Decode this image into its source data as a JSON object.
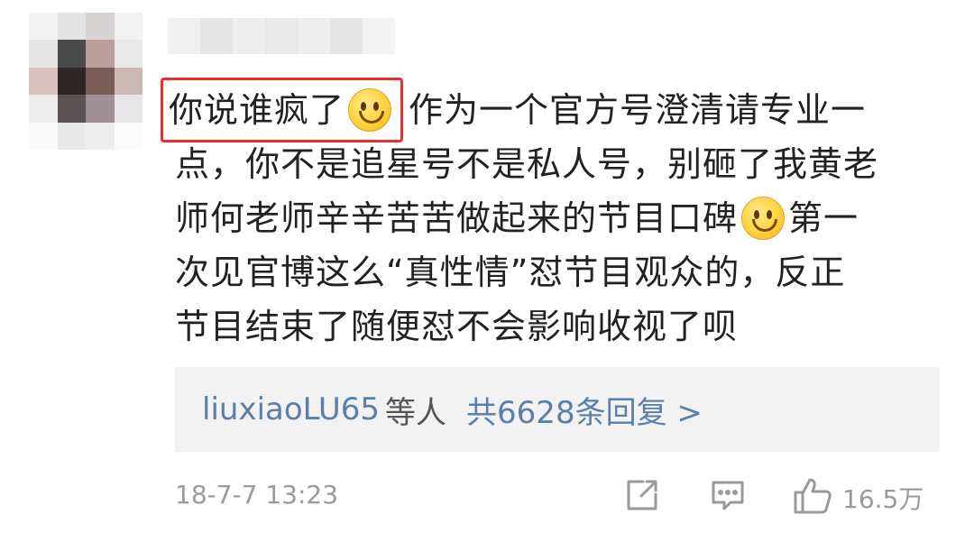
{
  "comment": {
    "highlight": "你说谁疯了",
    "line1_rest": "作为一个官方号澄清请专业一",
    "line2": "点，你不是追星号不是私人号，别砸了我黄老",
    "line3_pre": "师何老师辛辛苦苦做起来的节目口碑",
    "line3_post": "第一",
    "line4": "次见官博这么“真性情”怼节目观众的，反正",
    "line5": "节目结束了随便怼不会影响收视了呗"
  },
  "replies": {
    "user": "liuxiaoLU65",
    "suffix": "等人",
    "count_text": "共6628条回复 >"
  },
  "footer": {
    "timestamp": "18-7-7 13:23",
    "likes": "16.5万",
    "icons": [
      "share-icon",
      "comment-icon",
      "like-icon"
    ]
  },
  "colors": {
    "highlight_border": "#e8312f",
    "link_blue": "#5c7fa8",
    "reply_bg": "#f2f2f2",
    "meta_gray": "#9a9a9a"
  }
}
